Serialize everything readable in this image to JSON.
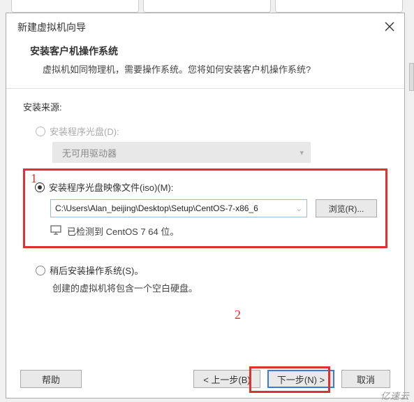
{
  "dialog": {
    "title": "新建虚拟机向导",
    "header_title": "安装客户机操作系统",
    "header_sub": "虚拟机如同物理机，需要操作系统。您将如何安装客户机操作系统?"
  },
  "source": {
    "label": "安装来源:",
    "opt_disc": "安装程序光盘(D):",
    "drive_none": "无可用驱动器",
    "opt_iso": "安装程序光盘映像文件(iso)(M):",
    "iso_path": "C:\\Users\\Alan_beijing\\Desktop\\Setup\\CentOS-7-x86_6",
    "browse": "浏览(R)...",
    "detected": "已检测到 CentOS 7 64 位。",
    "opt_later": "稍后安装操作系统(S)。",
    "later_sub": "创建的虚拟机将包含一个空白硬盘。"
  },
  "footer": {
    "help": "帮助",
    "back": "< 上一步(B)",
    "next": "下一步(N) >",
    "cancel": "取消"
  },
  "annotations": {
    "a1": "1",
    "a2": "2"
  },
  "watermark": "亿速云"
}
